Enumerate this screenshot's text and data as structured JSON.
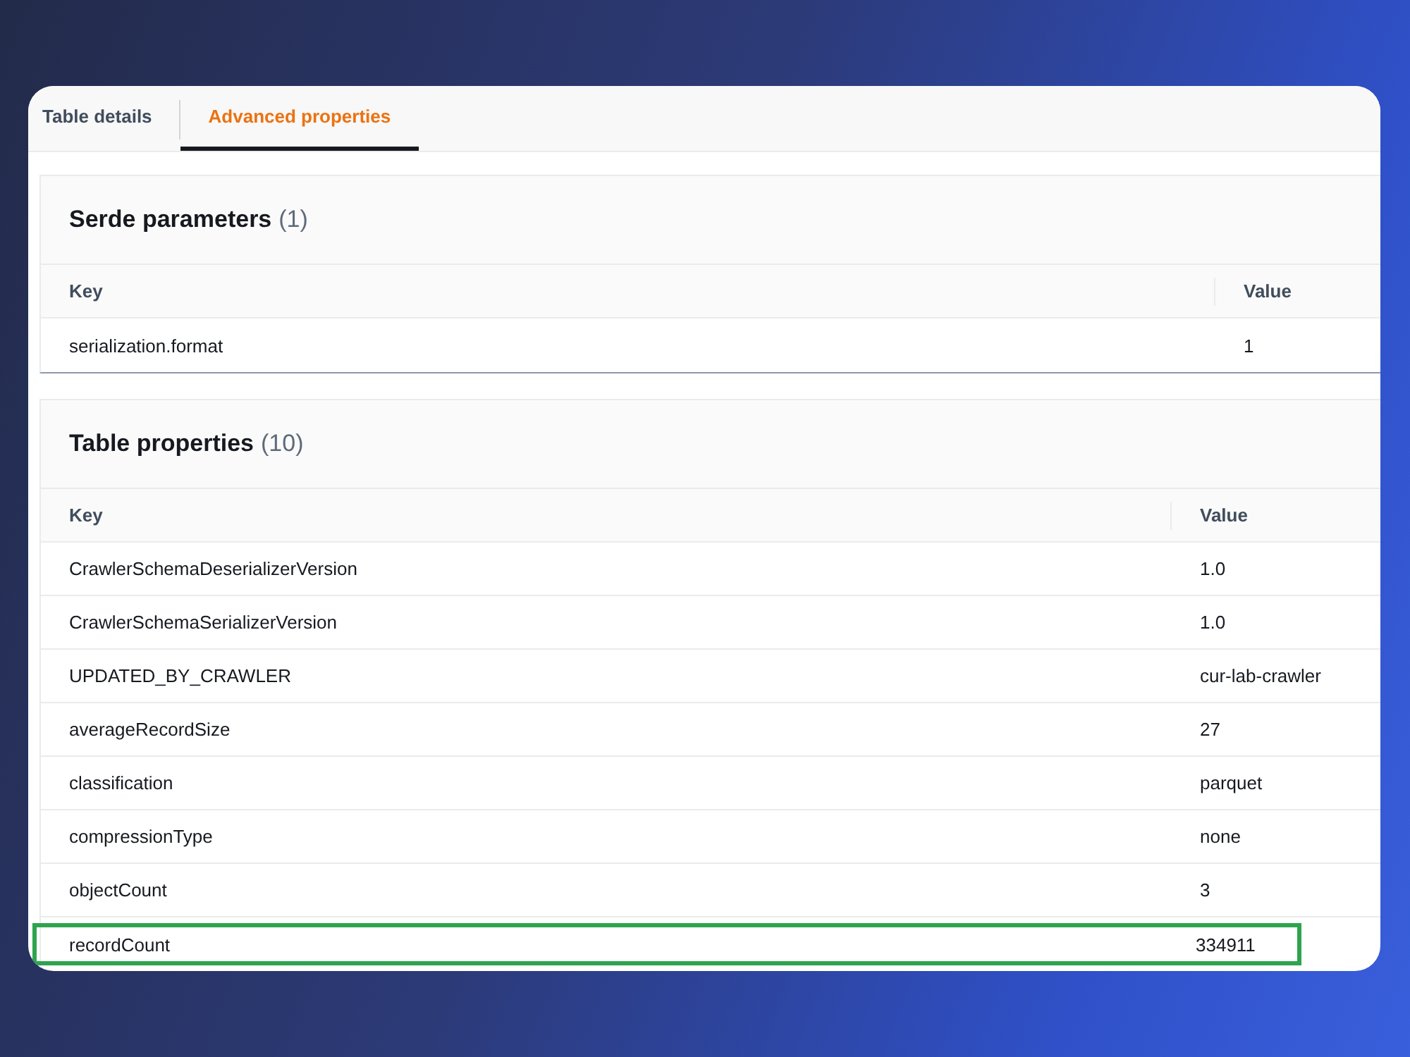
{
  "tabs": [
    {
      "label": "Table details",
      "selected": false
    },
    {
      "label": "Advanced properties",
      "selected": true
    }
  ],
  "panels": [
    {
      "title": "Serde parameters",
      "count": "(1)",
      "columns": [
        "Key",
        "Value"
      ],
      "rows": [
        {
          "key": "serialization.format",
          "value": "1",
          "highlighted": false
        }
      ]
    },
    {
      "title": "Table properties",
      "count": "(10)",
      "columns": [
        "Key",
        "Value"
      ],
      "rows": [
        {
          "key": "CrawlerSchemaDeserializerVersion",
          "value": "1.0",
          "highlighted": false
        },
        {
          "key": "CrawlerSchemaSerializerVersion",
          "value": "1.0",
          "highlighted": false
        },
        {
          "key": "UPDATED_BY_CRAWLER",
          "value": "cur-lab-crawler",
          "highlighted": false
        },
        {
          "key": "averageRecordSize",
          "value": "27",
          "highlighted": false
        },
        {
          "key": "classification",
          "value": "parquet",
          "highlighted": false
        },
        {
          "key": "compressionType",
          "value": "none",
          "highlighted": false
        },
        {
          "key": "objectCount",
          "value": "3",
          "highlighted": false
        },
        {
          "key": "recordCount",
          "value": "334911",
          "highlighted": true
        }
      ]
    }
  ]
}
